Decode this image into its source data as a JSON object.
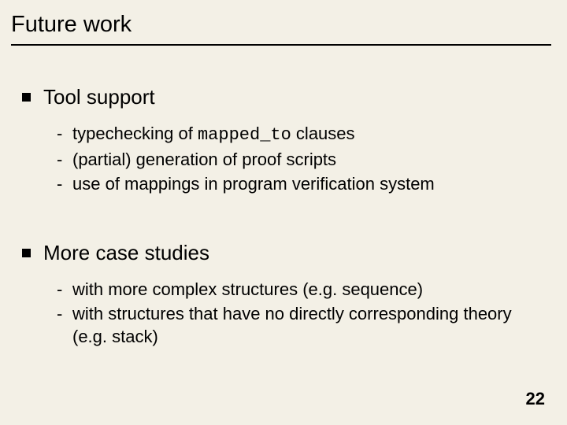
{
  "title": "Future work",
  "sections": [
    {
      "heading": "Tool support",
      "items": [
        {
          "pre": "typechecking of ",
          "code": "mapped_to",
          "post": " clauses"
        },
        {
          "pre": "(partial) generation of proof scripts"
        },
        {
          "pre": "use of mappings in program verification system"
        }
      ]
    },
    {
      "heading": "More case studies",
      "items": [
        {
          "pre": "with more complex structures (e.g. sequence)"
        },
        {
          "pre": "with structures that have no directly corresponding theory (e.g. stack)"
        }
      ]
    }
  ],
  "page_number": "22"
}
